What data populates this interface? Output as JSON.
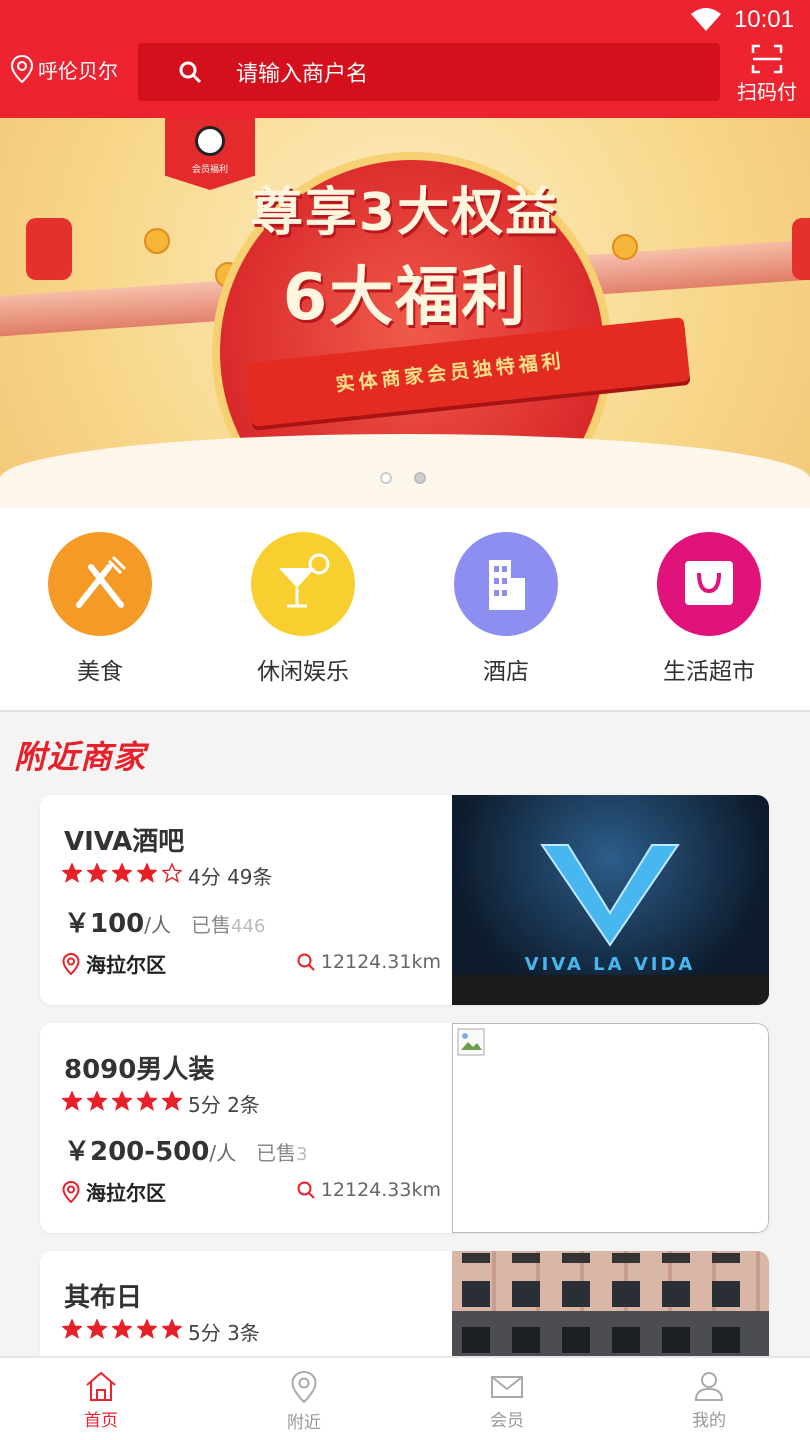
{
  "status_bar": {
    "time": "10:01"
  },
  "header": {
    "location": "呼伦贝尔",
    "search_placeholder": "请输入商户名",
    "scan_label": "扫码付"
  },
  "banner": {
    "badge_text": "会员福利",
    "line1": "尊享3大权益",
    "line2": "6大福利",
    "ribbon_text": "实体商家会员独特福利",
    "slide_count": 2,
    "active_slide": 1
  },
  "categories": [
    {
      "label": "美食",
      "icon": "utensils-icon",
      "color": "#f59a26"
    },
    {
      "label": "休闲娱乐",
      "icon": "cocktail-icon",
      "color": "#f8cf2e"
    },
    {
      "label": "酒店",
      "icon": "building-icon",
      "color": "#8d8ff0"
    },
    {
      "label": "生活超市",
      "icon": "shopping-bag-icon",
      "color": "#e0137b"
    }
  ],
  "nearby": {
    "title": "附近商家",
    "merchants": [
      {
        "name": "VIVA酒吧",
        "stars": 4,
        "rating_text": "4分 49条",
        "price": "￥100",
        "per": "/人",
        "sold_label": "已售",
        "sold": "446",
        "area": "海拉尔区",
        "distance": "12124.31km",
        "image": "viva-la-vida-image",
        "image_text": "VIVA LA VIDA"
      },
      {
        "name": "8090男人装",
        "stars": 5,
        "rating_text": "5分 2条",
        "price": "￥200-500",
        "per": "/人",
        "sold_label": "已售",
        "sold": "3",
        "area": "海拉尔区",
        "distance": "12124.33km",
        "image": "broken-image"
      },
      {
        "name": "其布日",
        "stars": 5,
        "rating_text": "5分 3条",
        "image": "building-photo"
      }
    ]
  },
  "tabbar": [
    {
      "label": "首页",
      "icon": "home-icon",
      "active": true
    },
    {
      "label": "附近",
      "icon": "location-pin-icon",
      "active": false
    },
    {
      "label": "会员",
      "icon": "envelope-icon",
      "active": false
    },
    {
      "label": "我的",
      "icon": "user-icon",
      "active": false
    }
  ],
  "colors": {
    "primary": "#ee2330",
    "star": "#e8202a"
  }
}
